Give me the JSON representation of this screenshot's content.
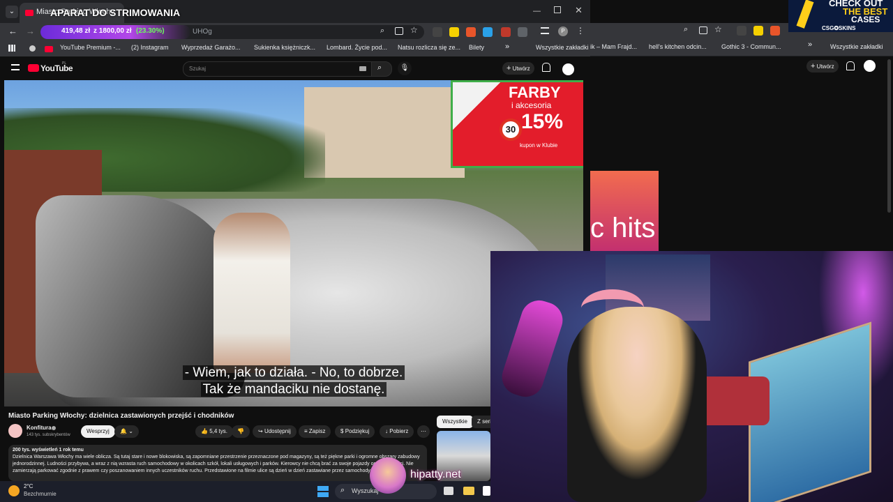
{
  "overlay": {
    "stream_title": "APARAT DO STRIMOWANIA",
    "donation_current": "419,48 zł",
    "donation_goal": "z 1800,00 zł",
    "donation_percent": "(23.30%)",
    "url_tail": "UHOg",
    "watermark": "hipatty.net"
  },
  "browser_left": {
    "tab_title": "Miasto Parking Włochy",
    "bookmarks": [
      "YouTube Premium -...",
      "(2) Instagram",
      "Wyprzedaż Garażo...",
      "Sukienka księżniczk...",
      "Lombard. Życie pod...",
      "Natsu rozlicza się ze...",
      "Bilety"
    ],
    "bookmarks_more": "»",
    "all_bookmarks": "Wszystkie zakładki"
  },
  "youtube": {
    "logo": "YouTube",
    "logo_region": "PL",
    "search_placeholder": "Szukaj",
    "create_label": "Utwórz",
    "video_title": "Miasto Parking Włochy: dzielnica zastawionych przejść i chodników",
    "channel_name": "Konfitura",
    "subscribers": "143 tys. subskrybentów",
    "support_label": "Wesprzyj",
    "likes": "5,4 tys.",
    "share_label": "Udostępnij",
    "save_label": "Zapisz",
    "thanks_label": "Podziękuj",
    "download_label": "Pobierz",
    "views_meta": "200 tys. wyświetleń  1 rok temu",
    "description": "Dzielnica Warszawa Włochy ma wiele oblicza. Są tutaj stare i nowe blokowiska, są zapomniane przestrzenie przeznaczone pod magazyny, są też piękne parki i ogromne obszary zabudowy jednorodzinnej. Ludności przybywa, a wraz z nią wzrasta ruch samochodowy w okolicach szkół, lokali usługowych i parków. Kierowcy nie chcą brać za swoje pojazdy ogromnej ilości. Nie zamierzają parkować zgodnie z prawem czy poszanowaniem innych uczestników ruchu. Przedstawione na filmie ulice są dzień w dzień zastawiane przez samochody",
    "filter_all": "Wszystkie",
    "filter_series": "Z serii",
    "subtitle_line1": "- Wiem, jak to działa. - No, to dobrze.",
    "subtitle_line2": "Tak że mandaciku nie dostanę."
  },
  "billboard": {
    "brand": "FARBY",
    "sub": "i akcesoria",
    "percent": "15%",
    "coupon": "kupon w Klubie",
    "sign": "30"
  },
  "browser_right": {
    "bookmarks": [
      "ik – Mam Frajd...",
      "hell's kitchen odcin...",
      "Gothic 3 - Commun..."
    ],
    "bookmarks_more": "»",
    "all_bookmarks": "Wszystkie zakładki",
    "create_label": "Utwórz",
    "thumb_text": "c hits"
  },
  "ad": {
    "line1": "CHECK OUT",
    "line2": "THE BEST",
    "line3": "CASES",
    "brand": "CSG✪SKINS"
  },
  "taskbar": {
    "temperature": "2°C",
    "weather": "Bezchmurnie",
    "search_placeholder": "Wyszukaj"
  }
}
